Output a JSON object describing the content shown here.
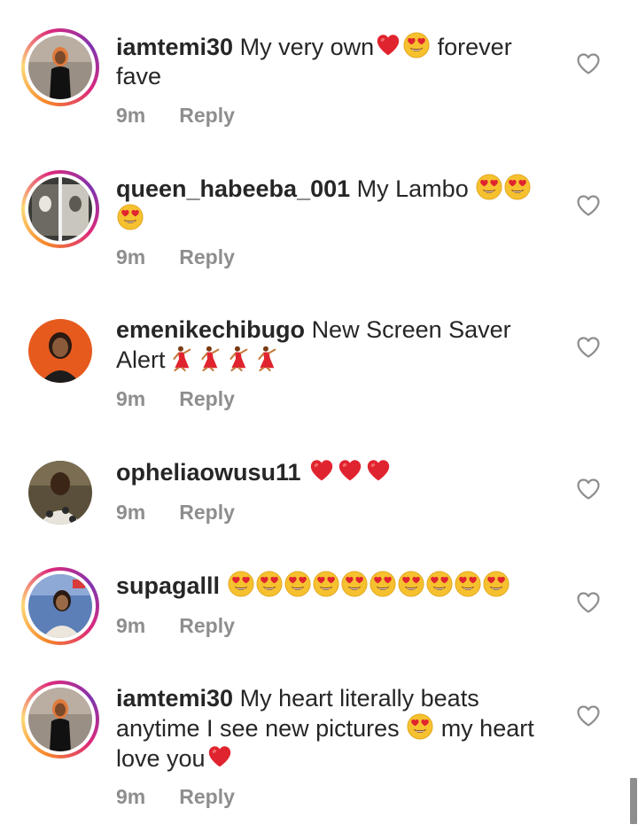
{
  "comments": [
    {
      "username": "iamtemi30",
      "text_parts": [
        "My very own",
        "forever",
        "fave"
      ],
      "time": "9m",
      "reply_label": "Reply"
    },
    {
      "username": "queen_habeeba_001",
      "text_parts": [
        "My Lambo"
      ],
      "time": "9m",
      "reply_label": "Reply"
    },
    {
      "username": "emenikechibugo",
      "text_parts": [
        "New Screen Saver",
        "Alert"
      ],
      "time": "9m",
      "reply_label": "Reply"
    },
    {
      "username": "opheliaowusu11",
      "text_parts": [],
      "time": "9m",
      "reply_label": "Reply"
    },
    {
      "username": "supagalll",
      "text_parts": [],
      "time": "9m",
      "reply_label": "Reply"
    },
    {
      "username": "iamtemi30",
      "text_parts": [
        "My heart literally beats",
        "anytime I see new pictures",
        "my heart",
        "love you"
      ],
      "time": "9m",
      "reply_label": "Reply"
    }
  ],
  "icons": {
    "like": "heart-outline-icon",
    "red_heart": "red-heart-emoji",
    "heart_eyes": "heart-eyes-emoji",
    "dancer": "dancer-emoji"
  },
  "colors": {
    "text": "#262626",
    "muted": "#8e8e8e",
    "heart_red": "#e0242f",
    "emoji_yellow": "#f6c12f"
  }
}
